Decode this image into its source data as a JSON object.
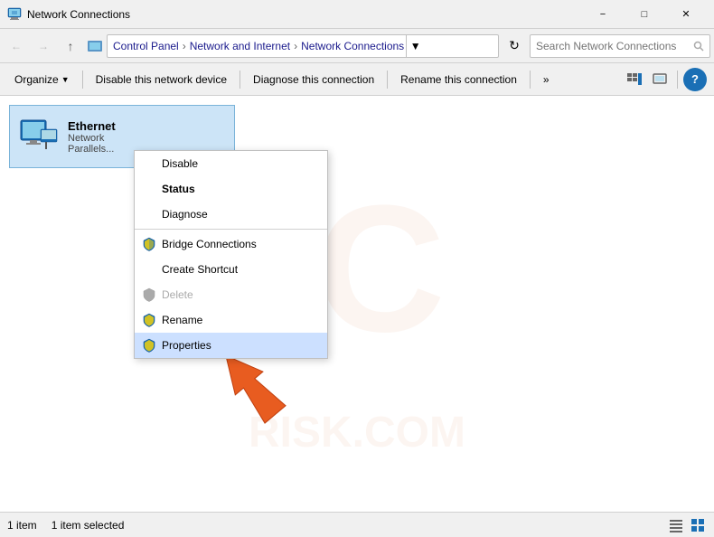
{
  "titleBar": {
    "title": "Network Connections",
    "iconLabel": "network-connections-icon",
    "minBtn": "−",
    "maxBtn": "□",
    "closeBtn": "✕"
  },
  "addressBar": {
    "back": "←",
    "forward": "→",
    "up": "↑",
    "breadcrumb": [
      "Control Panel",
      "Network and Internet",
      "Network Connections"
    ],
    "dropdownArrow": "▾",
    "refresh": "⟳",
    "searchPlaceholder": "Search Network Connections",
    "searchIcon": "🔍"
  },
  "toolbar": {
    "organize": "Organize",
    "organizeArrow": "▾",
    "disableNetwork": "Disable this network device",
    "diagnose": "Diagnose this connection",
    "rename": "Rename this connection",
    "more": "»",
    "help": "?"
  },
  "networkItem": {
    "name": "Ethernet",
    "type": "Network",
    "subtype": "Parallels..."
  },
  "contextMenu": {
    "items": [
      {
        "id": "disable",
        "label": "Disable",
        "bold": false,
        "disabled": false,
        "hasShield": false,
        "separator_after": false
      },
      {
        "id": "status",
        "label": "Status",
        "bold": true,
        "disabled": false,
        "hasShield": false,
        "separator_after": false
      },
      {
        "id": "diagnose",
        "label": "Diagnose",
        "bold": false,
        "disabled": false,
        "hasShield": false,
        "separator_after": true
      },
      {
        "id": "bridge",
        "label": "Bridge Connections",
        "bold": false,
        "disabled": false,
        "hasShield": true,
        "separator_after": false
      },
      {
        "id": "shortcut",
        "label": "Create Shortcut",
        "bold": false,
        "disabled": false,
        "hasShield": false,
        "separator_after": false
      },
      {
        "id": "delete",
        "label": "Delete",
        "bold": false,
        "disabled": true,
        "hasShield": true,
        "separator_after": false
      },
      {
        "id": "rename",
        "label": "Rename",
        "bold": false,
        "disabled": false,
        "hasShield": true,
        "separator_after": false
      },
      {
        "id": "properties",
        "label": "Properties",
        "bold": false,
        "disabled": false,
        "hasShield": true,
        "separator_after": false,
        "highlighted": true
      }
    ]
  },
  "statusBar": {
    "itemCount": "1 item",
    "selectedCount": "1 item selected"
  }
}
